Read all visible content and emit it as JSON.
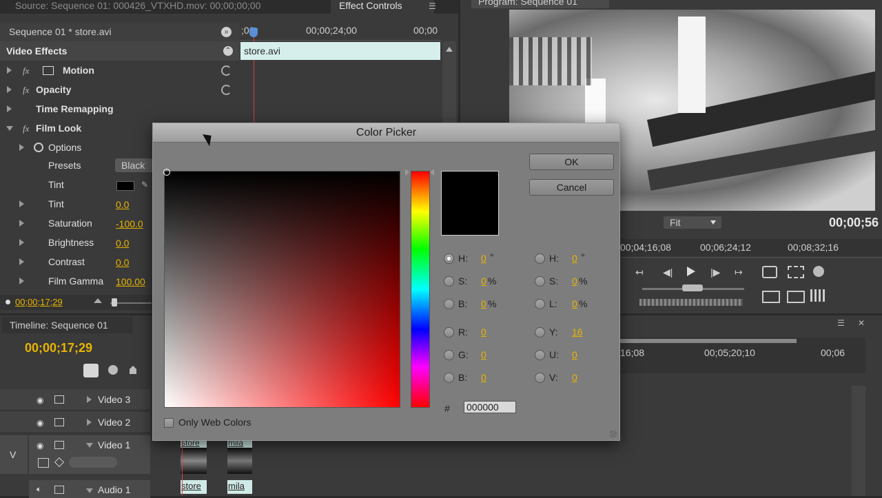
{
  "source_tab": {
    "label": "Source: Sequence 01: 000426_VTXHD.mov: 00;00;00;00"
  },
  "effect_controls": {
    "tab_label": "Effect Controls",
    "sequence_label": "Sequence 01 * store.avi",
    "section_title": "Video Effects",
    "ruler": {
      "start": ";00",
      "mid": "00;00;24;00",
      "end": "00;00"
    },
    "clip_name": "store.avi",
    "effects": [
      {
        "name": "Motion"
      },
      {
        "name": "Opacity"
      },
      {
        "name": "Time Remapping"
      },
      {
        "name": "Film Look"
      }
    ],
    "params": {
      "options": "Options",
      "presets": "Presets",
      "presets_value": "Black",
      "tint_color": "Tint",
      "tint": "Tint",
      "tint_value": "0.0",
      "saturation": "Saturation",
      "saturation_value": "-100.0",
      "brightness": "Brightness",
      "brightness_value": "0.0",
      "contrast": "Contrast",
      "contrast_value": "0.0",
      "film_gamma": "Film Gamma",
      "film_gamma_value": "100.00"
    },
    "timecode": "00;00;17;29"
  },
  "program": {
    "tab_label": "Program: Sequence 01",
    "fit_label": "Fit",
    "timecode": "00;00;56",
    "ruler": [
      "00;04;16;08",
      "00;06;24;12",
      "00;08;32;16"
    ]
  },
  "timeline": {
    "tab_label": "Timeline: Sequence 01",
    "timecode": "00;00;17;29",
    "ruler": [
      "16;08",
      "00;05;20;10",
      "00;06"
    ],
    "tracks": [
      "Video 3",
      "Video 2",
      "Video 1",
      "Audio 1"
    ],
    "v_label": "V",
    "clip_labels": [
      "store",
      "mila",
      "store",
      "mila"
    ]
  },
  "color_picker": {
    "title": "Color Picker",
    "ok": "OK",
    "cancel": "Cancel",
    "only_web_colors": "Only Web Colors",
    "hex_symbol": "#",
    "hex": "000000",
    "left_fields": [
      {
        "label": "H:",
        "value": "0",
        "unit": "°"
      },
      {
        "label": "S:",
        "value": "0",
        "unit": "%"
      },
      {
        "label": "B:",
        "value": "0",
        "unit": "%"
      },
      {
        "label": "R:",
        "value": "0",
        "unit": ""
      },
      {
        "label": "G:",
        "value": "0",
        "unit": ""
      },
      {
        "label": "B:",
        "value": "0",
        "unit": ""
      }
    ],
    "right_fields": [
      {
        "label": "H:",
        "value": "0",
        "unit": "°"
      },
      {
        "label": "S:",
        "value": "0",
        "unit": "%"
      },
      {
        "label": "L:",
        "value": "0",
        "unit": "%"
      },
      {
        "label": "Y:",
        "value": "16",
        "unit": ""
      },
      {
        "label": "U:",
        "value": "0",
        "unit": ""
      },
      {
        "label": "V:",
        "value": "0",
        "unit": ""
      }
    ],
    "selected_hue_color": "#ff0000",
    "current_color": "#000000"
  }
}
